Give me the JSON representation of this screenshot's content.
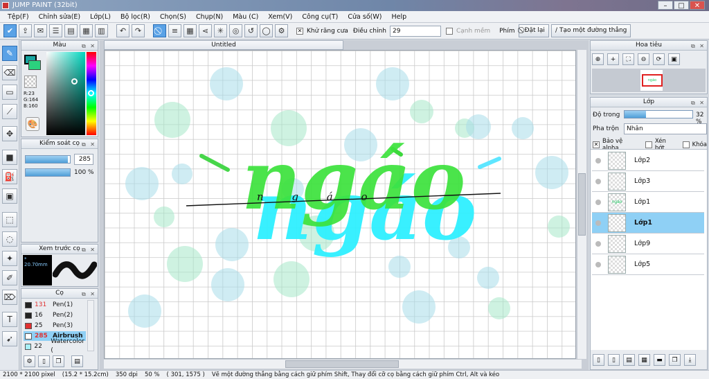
{
  "window": {
    "title": "JUMP PAINT (32bit)",
    "minimize": "–",
    "maximize": "□",
    "close": "✕"
  },
  "menu": [
    "Tệp(F)",
    "Chỉnh sửa(E)",
    "Lớp(L)",
    "Bộ lọc(R)",
    "Chọn(S)",
    "Chụp(N)",
    "Màu (C)",
    "Xem(V)",
    "Công cụ(T)",
    "Cửa số(W)",
    "Help"
  ],
  "toolbar": {
    "antialias_label": "Khử răng cưa",
    "adjust_label": "Điều chỉnh",
    "adjust_value": "29",
    "edge_label": "Cạnh mềm",
    "key_label": "Phím",
    "reset_label": "Đặt lại",
    "straight_label": "Tạo một đường thẳng"
  },
  "color_panel": {
    "title": "Màu",
    "r": "R:23",
    "g": "G:164",
    "b": "B:160",
    "fg": "#17a4a0",
    "bg": "#2bd17e"
  },
  "brush_control": {
    "title": "Kiểm soát cọ",
    "size": "285",
    "opacity": "100 %",
    "size_fill": 0.95,
    "opacity_fill": 1.0
  },
  "brush_preview": {
    "title": "Xem trước cọ",
    "size_text": "* 20.70mm"
  },
  "brush_list": {
    "title": "Cọ",
    "items": [
      {
        "num": "131",
        "name": "Pen(1)",
        "color": "#222222",
        "num_color": "#e03030"
      },
      {
        "num": "16",
        "name": "Pen(2)",
        "color": "#222222",
        "num_color": "#111111"
      },
      {
        "num": "25",
        "name": "Pen(3)",
        "color": "#e03030",
        "num_color": "#111111"
      },
      {
        "num": "285",
        "name": "Airbrush",
        "color": "#ffffff",
        "num_color": "#e03030",
        "selected": true
      },
      {
        "num": "22",
        "name": "Watercolor (",
        "color": "#a8f0f8",
        "num_color": "#111111"
      }
    ]
  },
  "document": {
    "tab_title": "Untitled",
    "word_main": "ngáo",
    "word_script": "n g á o",
    "bubble_colors": [
      "#a8dcea",
      "#a6e8c8"
    ]
  },
  "navigator": {
    "title": "Hoa tiêu"
  },
  "layers": {
    "title": "Lớp",
    "opacity_label": "Độ trong",
    "opacity_value": "32 %",
    "opacity_fill": 0.32,
    "blend_label": "Pha trộn",
    "blend_value": "Nhân",
    "protect_alpha": "Bảo vệ alpha",
    "clip": "Xén bớt",
    "lock": "Khóa",
    "items": [
      {
        "name": "Lớp2",
        "selected": false,
        "thumb": ""
      },
      {
        "name": "Lớp3",
        "selected": false,
        "thumb": ""
      },
      {
        "name": "Lớp1",
        "selected": false,
        "thumb": "ngáo"
      },
      {
        "name": "Lớp1",
        "selected": true,
        "thumb": ""
      },
      {
        "name": "Lớp9",
        "selected": false,
        "thumb": ""
      },
      {
        "name": "Lớp5",
        "selected": false,
        "thumb": ""
      }
    ]
  },
  "status": {
    "size": "2100 * 2100 pixel",
    "cm": "(15.2 * 15.2cm)",
    "dpi": "350 dpi",
    "zoom": "50 %",
    "coords": "( 301, 1575 )",
    "hint": "Vẽ một đường thẳng bằng cách giữ phím Shift, Thay đổi cỡ cọ bằng cách giữ phím Ctrl, Alt và kéo"
  }
}
